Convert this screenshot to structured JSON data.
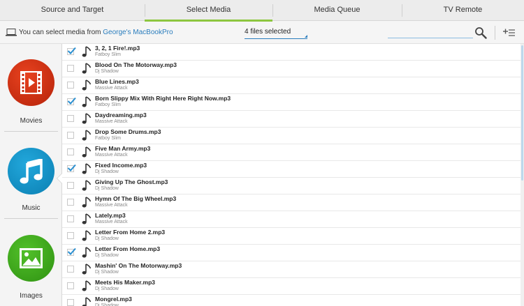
{
  "tabs": [
    {
      "label": "Source and Target"
    },
    {
      "label": "Select Media"
    },
    {
      "label": "Media Queue"
    },
    {
      "label": "TV Remote"
    }
  ],
  "active_tab": "Select Media",
  "toolbar": {
    "source_prefix": "You can select media from ",
    "source_device": "George's MacBookPro",
    "files_selected": "4 files selected",
    "search_placeholder": ""
  },
  "sidebar": {
    "categories": [
      {
        "label": "Movies",
        "color": "#cc2a0c"
      },
      {
        "label": "Music",
        "color": "#1094c9"
      },
      {
        "label": "Images",
        "color": "#3fa81a"
      }
    ],
    "selected": "Music"
  },
  "tracks": [
    {
      "title": "3, 2, 1 Fire!.mp3",
      "artist": "Fatboy Slim",
      "checked": true
    },
    {
      "title": "Blood On The Motorway.mp3",
      "artist": "Dj Shadow",
      "checked": false
    },
    {
      "title": "Blue Lines.mp3",
      "artist": "Massive Attack",
      "checked": false
    },
    {
      "title": "Born Slippy Mix With Right Here Right Now.mp3",
      "artist": "Fatboy Slim",
      "checked": true
    },
    {
      "title": "Daydreaming.mp3",
      "artist": "Massive Attack",
      "checked": false
    },
    {
      "title": "Drop Some Drums.mp3",
      "artist": "Fatboy Slim",
      "checked": false
    },
    {
      "title": "Five Man Army.mp3",
      "artist": "Massive Attack",
      "checked": false
    },
    {
      "title": "Fixed Income.mp3",
      "artist": "Dj Shadow",
      "checked": true
    },
    {
      "title": "Giving Up The Ghost.mp3",
      "artist": "Dj Shadow",
      "checked": false
    },
    {
      "title": "Hymn Of The Big Wheel.mp3",
      "artist": "Massive Attack",
      "checked": false
    },
    {
      "title": "Lately.mp3",
      "artist": "Massive Attack",
      "checked": false
    },
    {
      "title": "Letter From Home 2.mp3",
      "artist": "Dj Shadow",
      "checked": false
    },
    {
      "title": "Letter From Home.mp3",
      "artist": "Dj Shadow",
      "checked": true
    },
    {
      "title": "Mashin' On The Motorway.mp3",
      "artist": "Dj Shadow",
      "checked": false
    },
    {
      "title": "Meets His Maker.mp3",
      "artist": "Dj Shadow",
      "checked": false
    },
    {
      "title": "Mongrel.mp3",
      "artist": "Dj Shadow",
      "checked": false
    }
  ],
  "colors": {
    "accent": "#8dc63f",
    "link": "#2a7dbd",
    "check": "#2a8fd0"
  },
  "icons": [
    "laptop-icon",
    "search-icon",
    "add-list-icon",
    "video-icon",
    "music-note-icon",
    "image-icon",
    "checkmark-icon"
  ]
}
